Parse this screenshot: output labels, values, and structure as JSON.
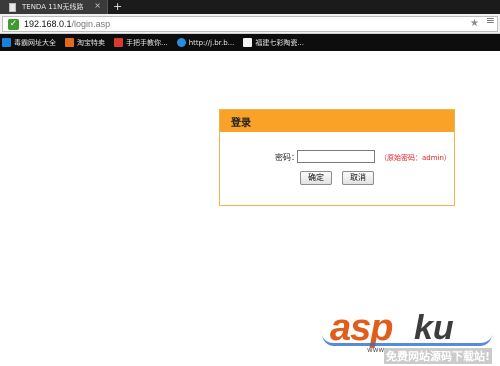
{
  "browser": {
    "tab": {
      "title": "TENDA 11N无线路",
      "close_glyph": "×",
      "new_tab_glyph": "+"
    },
    "address": {
      "host": "192.168.0.1",
      "path": "/login.asp"
    },
    "icons": {
      "secure": "check-shield-icon",
      "star": "star-icon",
      "menu": "menu-icon"
    },
    "bookmarks": [
      {
        "label": "毒霸网址大全",
        "icon_color": "#1a7fd8"
      },
      {
        "label": "淘宝特卖",
        "icon_color": "#e2691c"
      },
      {
        "label": "手把手教你...",
        "icon_color": "#d63a2f"
      },
      {
        "label": "http://j.br.b...",
        "icon_color": "#2a8ee0"
      },
      {
        "label": "福建七彩陶瓷...",
        "icon_color": "#f2f2f2"
      }
    ]
  },
  "login": {
    "title": "登录",
    "password_label": "密码：",
    "password_value": "",
    "hint": "（原始密码：admin）",
    "ok_label": "确定",
    "cancel_label": "取消",
    "accent_color": "#f9a227"
  },
  "watermark": {
    "brand_a": "asp",
    "brand_b": "ku",
    "url": "www",
    "tagline": "免费网站源码下载站!"
  }
}
